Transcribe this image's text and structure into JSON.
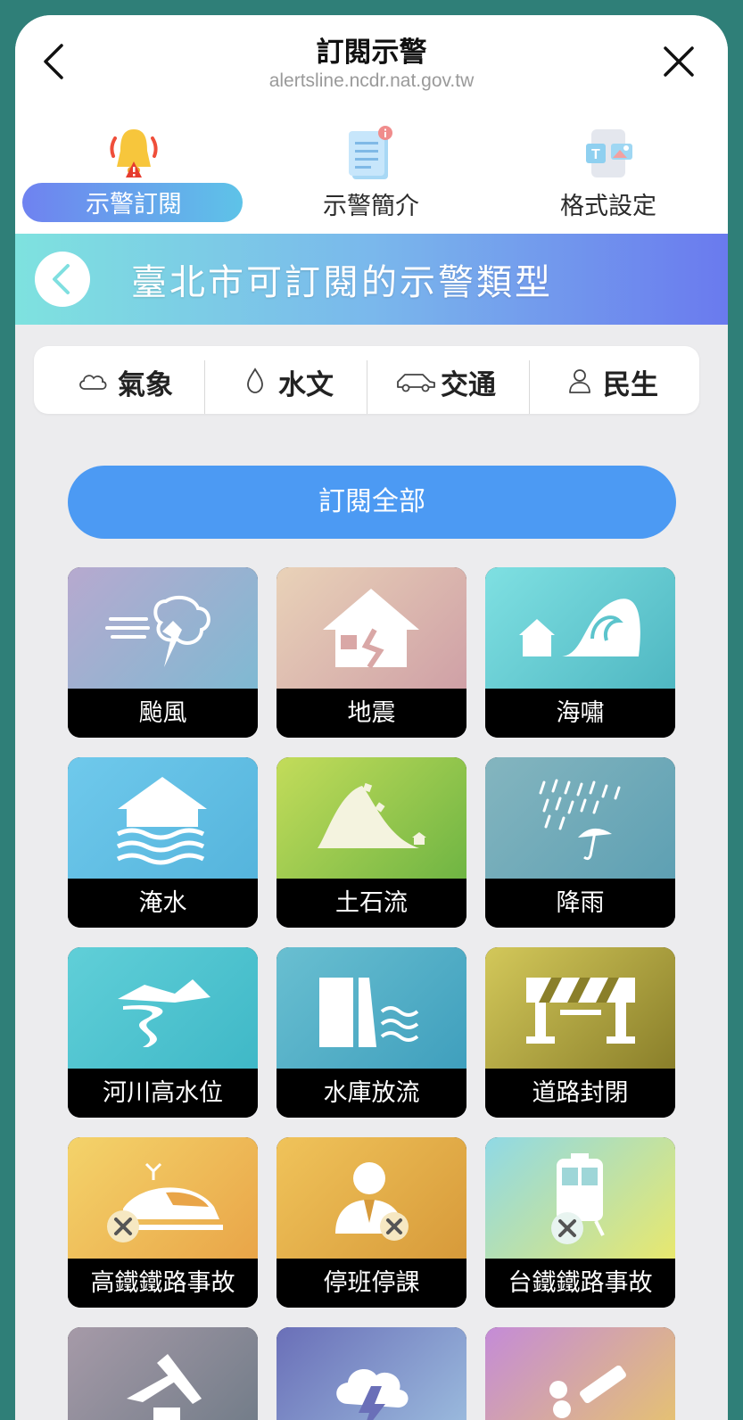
{
  "header": {
    "title": "訂閱示警",
    "url": "alertsline.ncdr.nat.gov.tw"
  },
  "tabs": [
    {
      "label": "示警訂閱",
      "icon": "alarm-bell-icon",
      "active": true
    },
    {
      "label": "示警簡介",
      "icon": "document-info-icon",
      "active": false
    },
    {
      "label": "格式設定",
      "icon": "format-settings-icon",
      "active": false
    }
  ],
  "banner": {
    "title": "臺北市可訂閱的示警類型"
  },
  "categories": [
    {
      "label": "氣象",
      "icon": "cloud-icon"
    },
    {
      "label": "水文",
      "icon": "water-drop-icon"
    },
    {
      "label": "交通",
      "icon": "car-icon"
    },
    {
      "label": "民生",
      "icon": "person-icon"
    }
  ],
  "subscribe_all": "訂閱全部",
  "alerts": [
    {
      "label": "颱風",
      "icon": "typhoon-icon",
      "colors": [
        "#b7a9cf",
        "#7fb9d2"
      ]
    },
    {
      "label": "地震",
      "icon": "earthquake-house-icon",
      "colors": [
        "#e9d2b8",
        "#cfa0a6"
      ]
    },
    {
      "label": "海嘯",
      "icon": "tsunami-icon",
      "colors": [
        "#7fe0e2",
        "#4fb7c2"
      ]
    },
    {
      "label": "淹水",
      "icon": "flood-icon",
      "colors": [
        "#6fc9ec",
        "#55b4dc"
      ]
    },
    {
      "label": "土石流",
      "icon": "landslide-icon",
      "colors": [
        "#c3dc5a",
        "#6fb543"
      ]
    },
    {
      "label": "降雨",
      "icon": "rain-umbrella-icon",
      "colors": [
        "#84b5bf",
        "#5ea0b3"
      ]
    },
    {
      "label": "河川高水位",
      "icon": "river-icon",
      "colors": [
        "#60cfd8",
        "#3fb8c7"
      ]
    },
    {
      "label": "水庫放流",
      "icon": "reservoir-icon",
      "colors": [
        "#69bfd1",
        "#3f9fbd"
      ]
    },
    {
      "label": "道路封閉",
      "icon": "road-barrier-icon",
      "colors": [
        "#d3c85a",
        "#8a7f2a"
      ]
    },
    {
      "label": "高鐵鐵路事故",
      "icon": "high-speed-rail-icon",
      "colors": [
        "#f4d36a",
        "#e9a548"
      ]
    },
    {
      "label": "停班停課",
      "icon": "office-closed-icon",
      "colors": [
        "#f0c35a",
        "#d79a3a"
      ]
    },
    {
      "label": "台鐵鐵路事故",
      "icon": "train-accident-icon",
      "colors": [
        "#8fd9e6",
        "#e8e86e"
      ]
    },
    {
      "label": "",
      "icon": "aviation-icon",
      "colors": [
        "#a69aa8",
        "#6e7a86"
      ]
    },
    {
      "label": "",
      "icon": "thunderstorm-icon",
      "colors": [
        "#6a6fb8",
        "#9ec0e0"
      ]
    },
    {
      "label": "",
      "icon": "epidemic-icon",
      "colors": [
        "#c48bd8",
        "#e8c66a"
      ]
    }
  ]
}
